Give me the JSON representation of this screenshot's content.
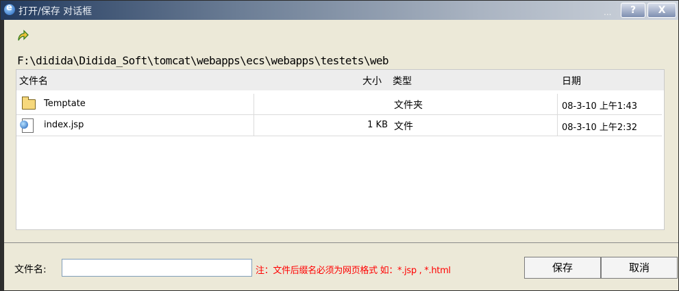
{
  "window": {
    "title": "打开/保存 对话框",
    "dots": "...",
    "help_label": "?",
    "close_label": "X"
  },
  "path": "F:\\didida\\Didida_Soft\\tomcat\\webapps\\ecs\\webapps\\testets\\web",
  "list": {
    "headers": {
      "name": "文件名",
      "size": "大小",
      "type": "类型",
      "date": "日期"
    },
    "rows": [
      {
        "name": "Temptate",
        "size": "",
        "type": "文件夹",
        "date": "08-3-10 上午1:43",
        "icon": "folder-icon"
      },
      {
        "name": "index.jsp",
        "size": "1 KB",
        "type": "文件",
        "date": "08-3-10 上午2:32",
        "icon": "ie-file-icon"
      }
    ]
  },
  "footer": {
    "filename_label": "文件名:",
    "filename_value": "",
    "note": "注：文件后缀名必须为网页格式 如：*.jsp , *.html",
    "save_label": "保存",
    "cancel_label": "取消"
  },
  "colors": {
    "note": "#ff0000",
    "title_bar": "#223a5e",
    "dialog_bg": "#ece9d8"
  }
}
